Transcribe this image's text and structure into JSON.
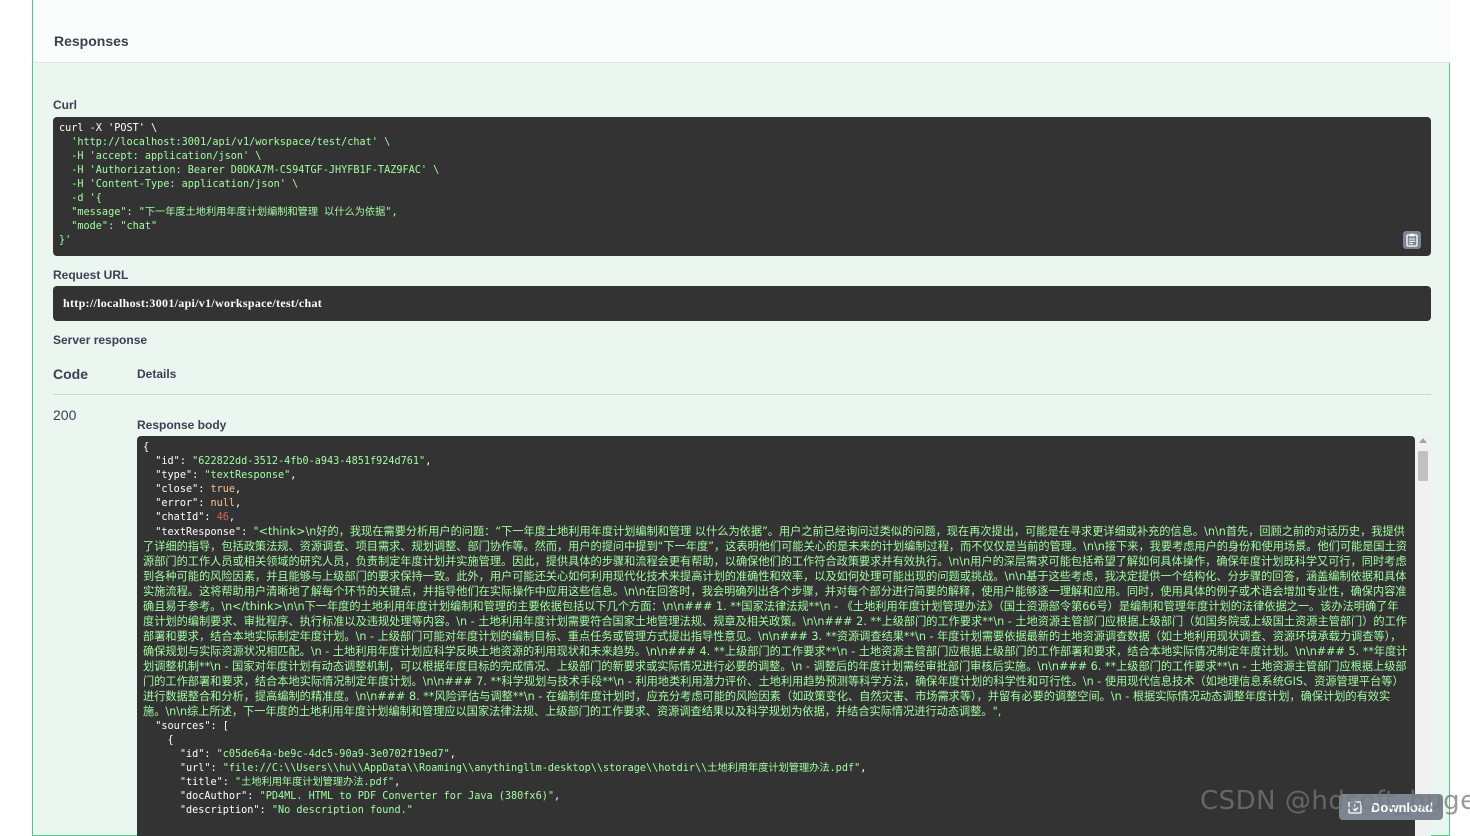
{
  "responses": {
    "title": "Responses",
    "curl_label": "Curl",
    "curl_lines": [
      "curl -X 'POST' \\",
      "  'http://localhost:3001/api/v1/workspace/test/chat' \\",
      "  -H 'accept: application/json' \\",
      "  -H 'Authorization: Bearer D0DKA7M-CS94TGF-JHYFB1F-TAZ9FAC' \\",
      "  -H 'Content-Type: application/json' \\",
      "  -d '{",
      "  \"message\": \"下一年度土地利用年度计划编制和管理 以什么为依据\",",
      "  \"mode\": \"chat\"",
      "}'"
    ],
    "copy_icon": "clipboard-icon",
    "request_url_label": "Request URL",
    "request_url": "http://localhost:3001/api/v1/workspace/test/chat",
    "server_response_label": "Server response",
    "col_code": "Code",
    "col_details": "Details",
    "status_code": "200",
    "response_body_label": "Response body",
    "body": {
      "open": "{",
      "id_key": "\"id\"",
      "id_val": "\"622822dd-3512-4fb0-a943-4851f924d761\"",
      "type_key": "\"type\"",
      "type_val": "\"textResponse\"",
      "close_key": "\"close\"",
      "close_val": "true",
      "error_key": "\"error\"",
      "error_val": "null",
      "chatId_key": "\"chatId\"",
      "chatId_val": "46",
      "textResponse_key": "\"textResponse\"",
      "textResponse_val": "\"<think>\\n好的，我现在需要分析用户的问题：“下一年度土地利用年度计划编制和管理 以什么为依据”。用户之前已经询问过类似的问题，现在再次提出，可能是在寻求更详细或补充的信息。\\n\\n首先，回顾之前的对话历史，我提供了详细的指导，包括政策法规、资源调查、项目需求、规划调整、部门协作等。然而，用户的提问中提到“下一年度”，这表明他们可能关心的是未来的计划编制过程，而不仅仅是当前的管理。\\n\\n接下来，我要考虑用户的身份和使用场景。他们可能是国土资源部门的工作人员或相关领域的研究人员，负责制定年度计划并实施管理。因此，提供具体的步骤和流程会更有帮助，以确保他们的工作符合政策要求并有效执行。\\n\\n用户的深层需求可能包括希望了解如何具体操作，确保年度计划既科学又可行，同时考虑到各种可能的风险因素，并且能够与上级部门的要求保持一致。此外，用户可能还关心如何利用现代化技术来提高计划的准确性和效率，以及如何处理可能出现的问题或挑战。\\n\\n基于这些考虑，我决定提供一个结构化、分步骤的回答，涵盖编制依据和具体实施流程。这将帮助用户清晰地了解每个环节的关键点，并指导他们在实际操作中应用这些信息。\\n\\n在回答时，我会明确列出各个步骤，并对每个部分进行简要的解释，使用户能够逐一理解和应用。同时，使用具体的例子或术语会增加专业性，确保内容准确且易于参考。\\n</think>\\n\\n下一年度的土地利用年度计划编制和管理的主要依据包括以下几个方面：\\n\\n### 1. **国家法律法规**\\n   - 《土地利用年度计划管理办法》（国土资源部令第66号）是编制和管理年度计划的法律依据之一。该办法明确了年度计划的编制要求、审批程序、执行标准以及违规处理等内容。\\n   - 土地利用年度计划需要符合国家土地管理法规、规章及相关政策。\\n\\n### 2. **上级部门的工作要求**\\n   - 土地资源主管部门应根据上级部门（如国务院或上级国土资源主管部门）的工作部署和要求，结合本地实际制定年度计划。\\n   - 上级部门可能对年度计划的编制目标、重点任务或管理方式提出指导性意见。\\n\\n### 3. **资源调查结果**\\n   - 年度计划需要依据最新的土地资源调查数据（如土地利用现状调查、资源环境承载力调查等），确保规划与实际资源状况相匹配。\\n   - 土地利用年度计划应科学反映土地资源的利用现状和未来趋势。\\n\\n### 4. **上级部门的工作要求**\\n   - 土地资源主管部门应根据上级部门的工作部署和要求，结合本地实际情况制定年度计划。\\n\\n### 5. **年度计划调整机制**\\n   - 国家对年度计划有动态调整机制，可以根据年度目标的完成情况、上级部门的新要求或实际情况进行必要的调整。\\n   - 调整后的年度计划需经审批部门审核后实施。\\n\\n### 6. **上级部门的工作要求**\\n   - 土地资源主管部门应根据上级部门的工作部署和要求，结合本地实际情况制定年度计划。\\n\\n### 7. **科学规划与技术手段**\\n   - 利用地类利用潜力评价、土地利用趋势预测等科学方法，确保年度计划的科学性和可行性。\\n   - 使用现代信息技术（如地理信息系统GIS、资源管理平台等）进行数据整合和分析，提高编制的精准度。\\n\\n### 8. **风险评估与调整**\\n   - 在编制年度计划时，应充分考虑可能的风险因素（如政策变化、自然灾害、市场需求等），并留有必要的调整空间。\\n   - 根据实际情况动态调整年度计划，确保计划的有效实施。\\n\\n综上所述，下一年度的土地利用年度计划编制和管理应以国家法律法规、上级部门的工作要求、资源调查结果以及科学规划为依据，并结合实际情况进行动态调整。\",",
      "sources_key": "\"sources\"",
      "src_id_key": "\"id\"",
      "src_id_val": "\"c05de64a-be9c-4dc5-90a9-3e0702f19ed7\"",
      "src_url_key": "\"url\"",
      "src_url_val": "\"file://C:\\\\Users\\\\hu\\\\AppData\\\\Roaming\\\\anythingllm-desktop\\\\storage\\\\hotdir\\\\土地利用年度计划管理办法.pdf\"",
      "src_title_key": "\"title\"",
      "src_title_val": "\"土地利用年度计划管理办法.pdf\"",
      "src_docAuthor_key": "\"docAuthor\"",
      "src_docAuthor_val": "\"PD4ML. HTML to PDF Converter for Java (380fx6)\"",
      "src_description_key": "\"description\"",
      "src_description_val": "\"No description found.\""
    },
    "download_label": "Download",
    "download_icon": "download-icon"
  },
  "watermark": "CSDN @hdsoft_huge",
  "colors": {
    "accent_green": "#49cc90",
    "panel_bg": "#ebf6f1",
    "code_bg": "#333333",
    "string_green": "#a2fca2",
    "literal_orange": "#fcc28c",
    "number_red": "#d36363"
  }
}
